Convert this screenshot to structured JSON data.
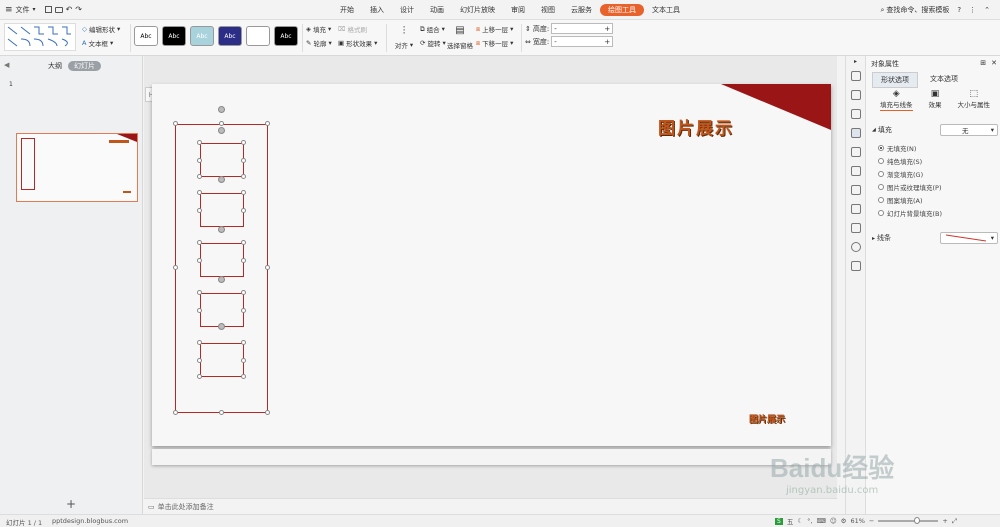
{
  "titlebar": {
    "file_menu": "文件",
    "tabs": [
      "开始",
      "插入",
      "设计",
      "动画",
      "幻灯片放映",
      "审阅",
      "视图",
      "云服务",
      "绘图工具",
      "文本工具"
    ],
    "active_tab_index": 8,
    "search_label": "查找命令、搜索模板",
    "help_icon": "?"
  },
  "ribbon": {
    "edit_shape": "编辑形状",
    "text_box": "文本框",
    "style_label": "Abc",
    "fill": "填充",
    "format_painter": "格式刷",
    "outline": "轮廓",
    "shape_effect": "形状效果",
    "align": "对齐",
    "group": "组合",
    "rotate": "旋转",
    "selection_pane": "选择窗格",
    "bring_forward": "上移一层",
    "send_backward": "下移一层",
    "height_label": "高度:",
    "width_label": "宽度:",
    "height_value": "-",
    "width_value": "-",
    "style_colors": [
      "#ffffff",
      "#000000",
      "#a9d3dc",
      "#2b2d86",
      "#ffffff",
      "#000000"
    ]
  },
  "left_panel": {
    "tab_outline": "大纲",
    "tab_slides": "幻灯片",
    "slide_number": "1",
    "add_slide": "+"
  },
  "slide": {
    "title": "图片展示",
    "bottom_text": "图片展示",
    "title_color": "#c0561c"
  },
  "notes": {
    "placeholder": "单击此处添加备注"
  },
  "right_panel": {
    "title": "对象属性",
    "tab_shape": "形状选项",
    "tab_text": "文本选项",
    "subtabs": [
      "填充与线条",
      "效果",
      "大小与属性"
    ],
    "fill_section": "填充",
    "fill_value": "无",
    "fill_options": [
      "无填充(N)",
      "纯色填充(S)",
      "渐变填充(G)",
      "图片或纹理填充(P)",
      "图案填充(A)",
      "幻灯片背景填充(B)"
    ],
    "selected_fill_index": 0,
    "line_section": "线条"
  },
  "statusbar": {
    "slide_info": "幻灯片 1 / 1",
    "theme_name": "pptdesign.blogbus.com",
    "zoom": "61%",
    "watermark_line1": "Baidu经验",
    "watermark_line2": "jingyan.baidu.com"
  }
}
